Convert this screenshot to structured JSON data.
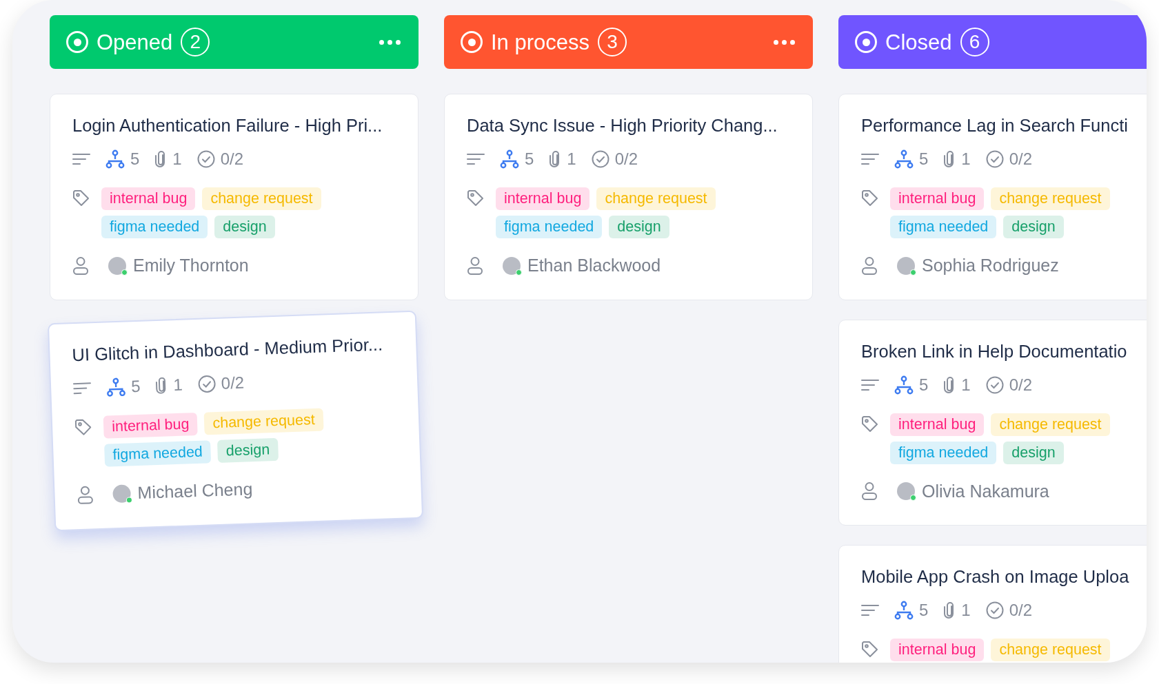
{
  "columns": [
    {
      "title": "Opened",
      "count": "2",
      "color": "#00c96e",
      "menu": true,
      "cards": [
        {
          "title": "Login Authentication Failure - High Pri...",
          "dragging": false,
          "subtasks": "5",
          "attachments": "1",
          "checklist": "0/2",
          "tags": [
            {
              "label": "internal bug",
              "color": "#ff1f7d"
            },
            {
              "label": "change request",
              "color": "#f5b900"
            },
            {
              "label": "figma needed",
              "color": "#12a8e0"
            },
            {
              "label": "design",
              "color": "#17a06a"
            }
          ],
          "assignee": {
            "name": "Emily Thornton",
            "online": true
          }
        },
        {
          "title": "UI Glitch in Dashboard - Medium Prior...",
          "dragging": true,
          "subtasks": "5",
          "attachments": "1",
          "checklist": "0/2",
          "tags": [
            {
              "label": "internal bug",
              "color": "#ff1f7d"
            },
            {
              "label": "change request",
              "color": "#f5b900"
            },
            {
              "label": "figma needed",
              "color": "#12a8e0"
            },
            {
              "label": "design",
              "color": "#17a06a"
            }
          ],
          "assignee": {
            "name": "Michael Cheng",
            "online": true
          }
        }
      ]
    },
    {
      "title": "In process",
      "count": "3",
      "color": "#ff5530",
      "menu": true,
      "cards": [
        {
          "title": "Data Sync Issue - High Priority Chang...",
          "dragging": false,
          "subtasks": "5",
          "attachments": "1",
          "checklist": "0/2",
          "tags": [
            {
              "label": "internal bug",
              "color": "#ff1f7d"
            },
            {
              "label": "change request",
              "color": "#f5b900"
            },
            {
              "label": "figma needed",
              "color": "#12a8e0"
            },
            {
              "label": "design",
              "color": "#17a06a"
            }
          ],
          "assignee": {
            "name": "Ethan Blackwood",
            "online": true
          }
        }
      ]
    },
    {
      "title": "Closed",
      "count": "6",
      "color": "#7055ff",
      "menu": false,
      "cards": [
        {
          "title": "Performance Lag in Search Functi",
          "dragging": false,
          "subtasks": "5",
          "attachments": "1",
          "checklist": "0/2",
          "tags": [
            {
              "label": "internal bug",
              "color": "#ff1f7d"
            },
            {
              "label": "change request",
              "color": "#f5b900"
            },
            {
              "label": "figma needed",
              "color": "#12a8e0"
            },
            {
              "label": "design",
              "color": "#17a06a"
            }
          ],
          "assignee": {
            "name": "Sophia Rodriguez",
            "online": true
          }
        },
        {
          "title": "Broken Link in Help Documentatio",
          "dragging": false,
          "subtasks": "5",
          "attachments": "1",
          "checklist": "0/2",
          "tags": [
            {
              "label": "internal bug",
              "color": "#ff1f7d"
            },
            {
              "label": "change request",
              "color": "#f5b900"
            },
            {
              "label": "figma needed",
              "color": "#12a8e0"
            },
            {
              "label": "design",
              "color": "#17a06a"
            }
          ],
          "assignee": {
            "name": "Olivia Nakamura",
            "online": true
          }
        },
        {
          "title": "Mobile App Crash on Image Uploa",
          "dragging": false,
          "subtasks": "5",
          "attachments": "1",
          "checklist": "0/2",
          "tags": [
            {
              "label": "internal bug",
              "color": "#ff1f7d"
            },
            {
              "label": "change request",
              "color": "#f5b900"
            }
          ]
        }
      ]
    }
  ]
}
